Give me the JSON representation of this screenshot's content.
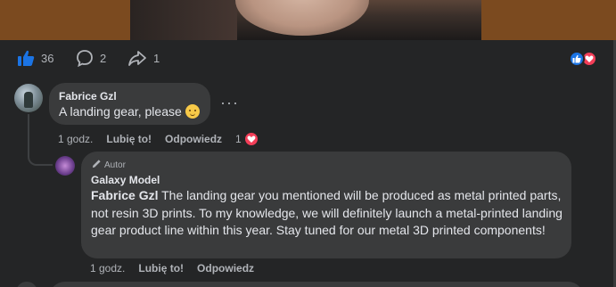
{
  "post": {
    "likes_count": "36",
    "comments_count": "2",
    "shares_count": "1"
  },
  "comment1": {
    "author": "Fabrice Gzl",
    "text": "A landing gear, please",
    "time": "1 godz.",
    "like_label": "Lubię to!",
    "reply_label": "Odpowiedz",
    "reaction_count": "1",
    "more_label": "···"
  },
  "reply1": {
    "author_badge": "Autor",
    "author": "Galaxy Model",
    "mention": "Fabrice Gzl",
    "text": " The landing gear you mentioned will be produced as metal printed parts, not resin 3D prints. To my knowledge, we will definitely launch a metal-printed landing gear product line within this year. Stay tuned for our metal 3D printed components!",
    "time": "1 godz.",
    "like_label": "Lubię to!",
    "reply_label": "Odpowiedz"
  },
  "colors": {
    "background": "#242526",
    "bubble": "#3a3b3c",
    "like_blue": "#1b74e4",
    "heart_red": "#f33e58",
    "muted_text": "#b0b3b8"
  },
  "icons": [
    "thumbs-up-icon",
    "comment-icon",
    "share-icon",
    "like-reaction-icon",
    "love-reaction-icon",
    "pencil-icon"
  ]
}
